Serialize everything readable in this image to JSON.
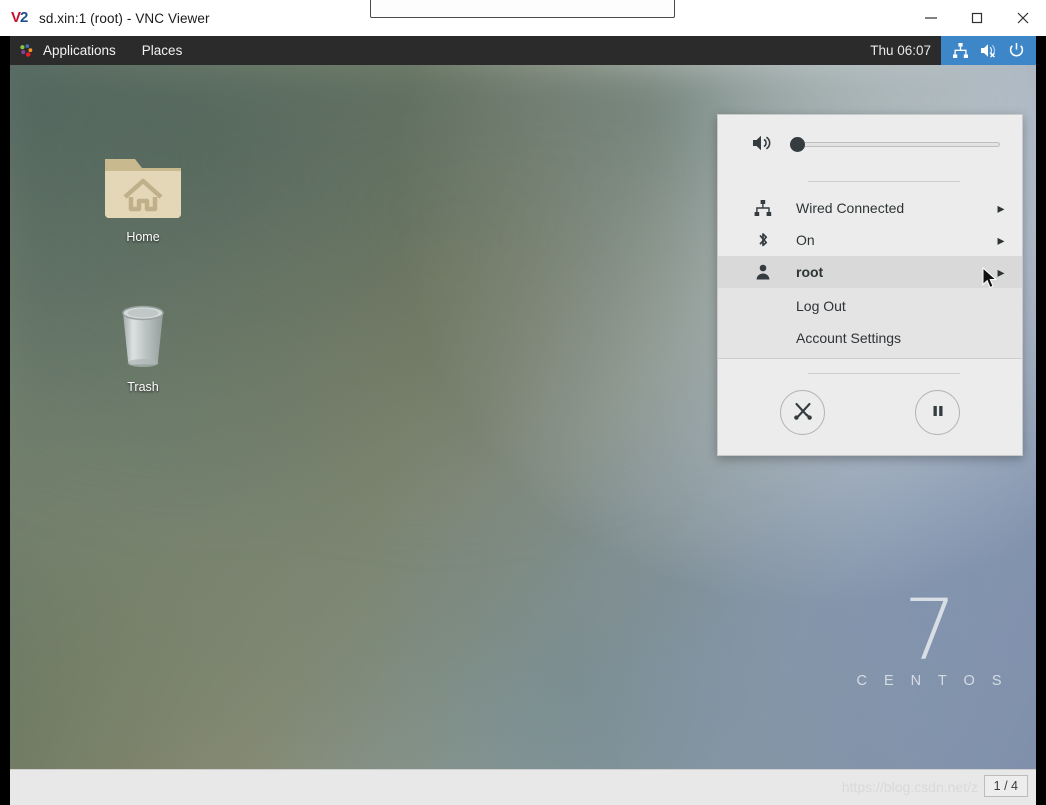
{
  "window": {
    "title": "sd.xin:1 (root) - VNC Viewer",
    "icon": "vnc-logo-icon",
    "controls": {
      "minimize": "minimize-button",
      "maximize": "maximize-button",
      "close": "close-button"
    }
  },
  "panel": {
    "applications_label": "Applications",
    "places_label": "Places",
    "clock": "Thu 06:07",
    "status_icons": [
      "network-wired-icon",
      "volume-muted-icon",
      "power-icon"
    ],
    "background": "#2b2b2b",
    "status_highlight": "#3d87c9"
  },
  "desktop": {
    "icons": [
      {
        "name": "home",
        "label": "Home"
      },
      {
        "name": "trash",
        "label": "Trash"
      }
    ],
    "watermark": {
      "version": "7",
      "distro": "C E N T O S"
    }
  },
  "system_menu": {
    "volume": {
      "icon": "volume-icon",
      "value": 0
    },
    "items": [
      {
        "name": "wired",
        "icon": "network-wired-icon",
        "label": "Wired Connected",
        "chevron": "▸",
        "expanded": false
      },
      {
        "name": "bluetooth",
        "icon": "bluetooth-icon",
        "label": "On",
        "chevron": "▸",
        "expanded": false
      },
      {
        "name": "user",
        "icon": "user-icon",
        "label": "root",
        "chevron": "▸",
        "expanded": true
      }
    ],
    "submenu": [
      {
        "name": "log-out",
        "label": "Log Out"
      },
      {
        "name": "account-settings",
        "label": "Account Settings"
      }
    ],
    "buttons": [
      {
        "name": "settings",
        "icon": "tools-icon"
      },
      {
        "name": "suspend",
        "icon": "pause-icon"
      }
    ],
    "background": "#ececec",
    "highlight": "#d9d9d9"
  },
  "statusbar": {
    "watermark": "https://blog.csdn.net/z",
    "pager": "1 / 4"
  }
}
